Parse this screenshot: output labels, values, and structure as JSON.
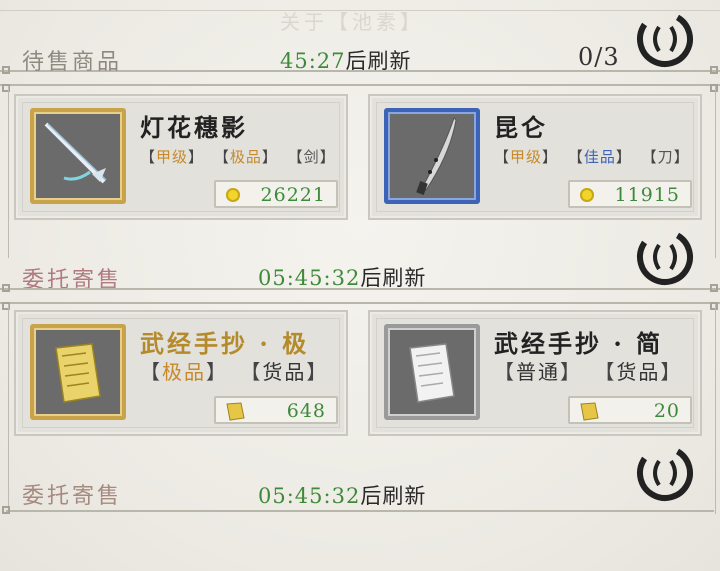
{
  "ghost_title": "关于【池素】",
  "sections": [
    {
      "label": "待售商品",
      "timer": "45:27",
      "timer_suffix": "后刷新",
      "count": "0/3",
      "cards": [
        {
          "name": "灯花穗影",
          "tags": [
            {
              "text": "甲级",
              "color": "#c78a2a"
            },
            {
              "text": "极品",
              "color": "#c78a2a"
            },
            {
              "text": "剑",
              "color": "#555555"
            }
          ],
          "price": "26221",
          "currency": "coin-icon",
          "frame": "gold",
          "item_icon": "sword-icon"
        },
        {
          "name": "昆仑",
          "tags": [
            {
              "text": "甲级",
              "color": "#c78a2a"
            },
            {
              "text": "佳品",
              "color": "#3d63b8"
            },
            {
              "text": "刀",
              "color": "#555555"
            }
          ],
          "price": "11915",
          "currency": "coin-icon",
          "frame": "blue",
          "item_icon": "blade-icon"
        }
      ]
    },
    {
      "label": "委托寄售",
      "timer": "05:45:32",
      "timer_suffix": "后刷新",
      "cards": [
        {
          "name": "武经手抄 · 极",
          "tags": [
            {
              "text": "极品",
              "color": "#c78a2a"
            },
            {
              "text": "货品",
              "color": "#333333"
            }
          ],
          "price": "648",
          "currency": "scroll-icon",
          "frame": "gold",
          "item_icon": "scroll-gold-icon"
        },
        {
          "name": "武经手抄 · 简",
          "tags": [
            {
              "text": "普通",
              "color": "#333333"
            },
            {
              "text": "货品",
              "color": "#333333"
            }
          ],
          "price": "20",
          "currency": "scroll-icon",
          "frame": "gray",
          "item_icon": "scroll-white-icon"
        }
      ]
    },
    {
      "label": "委托寄售",
      "timer": "05:45:32",
      "timer_suffix": "后刷新"
    }
  ],
  "colors": {
    "price_green": "#3f8a3a",
    "gold": "#c8a34a",
    "blue": "#3c63b5"
  }
}
